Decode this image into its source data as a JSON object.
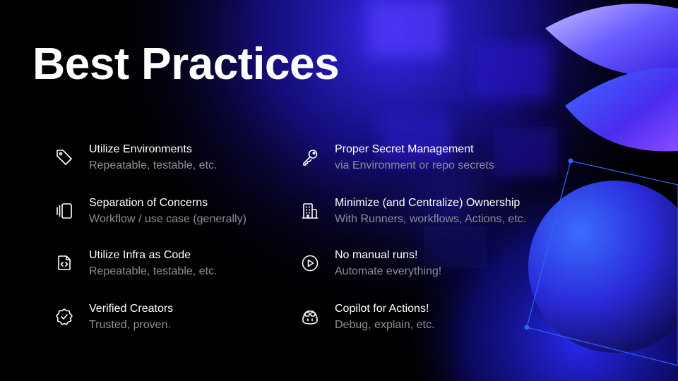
{
  "slide": {
    "title": "Best Practices",
    "items": [
      {
        "heading": "Utilize Environments",
        "subtext": "Repeatable, testable, etc.",
        "icon": "tag-icon"
      },
      {
        "heading": "Separation of Concerns",
        "subtext": "Workflow / use case (generally)",
        "icon": "stacked-cards-icon"
      },
      {
        "heading": "Utilize Infra as Code",
        "subtext": "Repeatable, testable, etc.",
        "icon": "code-file-icon"
      },
      {
        "heading": "Verified Creators",
        "subtext": "Trusted, proven.",
        "icon": "verified-badge-icon"
      },
      {
        "heading": "Proper Secret Management",
        "subtext": "via Environment or repo secrets",
        "icon": "key-icon"
      },
      {
        "heading": "Minimize (and Centralize) Ownership",
        "subtext": "With Runners, workflows, Actions, etc.",
        "icon": "organization-icon"
      },
      {
        "heading": "No manual runs!",
        "subtext": "Automate everything!",
        "icon": "play-icon"
      },
      {
        "heading": "Copilot for Actions!",
        "subtext": "Debug, explain, etc.",
        "icon": "copilot-icon"
      }
    ]
  },
  "colors": {
    "background": "#000000",
    "heading": "#ffffff",
    "subtext": "#8d8d99",
    "accent": "#3a34ff"
  }
}
